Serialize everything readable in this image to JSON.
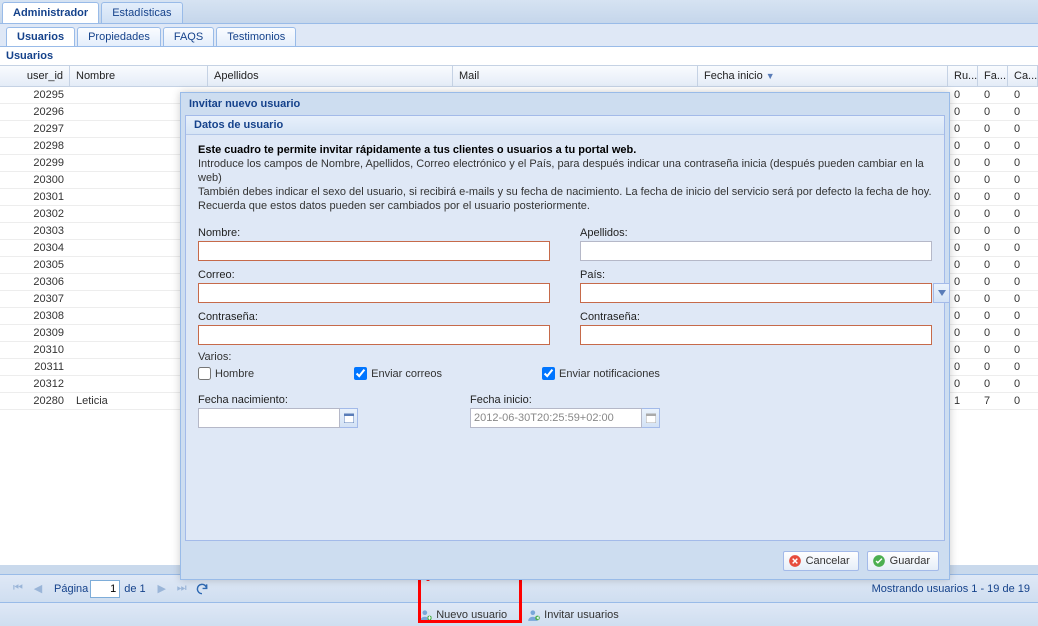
{
  "topTabs": {
    "admin": "Administrador",
    "stats": "Estadísticas"
  },
  "subTabs": {
    "users": "Usuarios",
    "props": "Propiedades",
    "faqs": "FAQS",
    "testi": "Testimonios"
  },
  "panelTitle": "Usuarios",
  "columns": {
    "user_id": "user_id",
    "nombre": "Nombre",
    "apellidos": "Apellidos",
    "mail": "Mail",
    "fecha": "Fecha inicio",
    "ru": "Ru...",
    "fa": "Fa...",
    "ca": "Ca..."
  },
  "rows": [
    {
      "id": "20295",
      "nom": "",
      "r": "0",
      "f": "0",
      "c": "0"
    },
    {
      "id": "20296",
      "nom": "",
      "r": "0",
      "f": "0",
      "c": "0"
    },
    {
      "id": "20297",
      "nom": "",
      "r": "0",
      "f": "0",
      "c": "0"
    },
    {
      "id": "20298",
      "nom": "",
      "r": "0",
      "f": "0",
      "c": "0"
    },
    {
      "id": "20299",
      "nom": "",
      "r": "0",
      "f": "0",
      "c": "0"
    },
    {
      "id": "20300",
      "nom": "",
      "r": "0",
      "f": "0",
      "c": "0"
    },
    {
      "id": "20301",
      "nom": "",
      "r": "0",
      "f": "0",
      "c": "0"
    },
    {
      "id": "20302",
      "nom": "",
      "r": "0",
      "f": "0",
      "c": "0"
    },
    {
      "id": "20303",
      "nom": "",
      "r": "0",
      "f": "0",
      "c": "0"
    },
    {
      "id": "20304",
      "nom": "",
      "r": "0",
      "f": "0",
      "c": "0"
    },
    {
      "id": "20305",
      "nom": "",
      "r": "0",
      "f": "0",
      "c": "0"
    },
    {
      "id": "20306",
      "nom": "",
      "r": "0",
      "f": "0",
      "c": "0"
    },
    {
      "id": "20307",
      "nom": "",
      "r": "0",
      "f": "0",
      "c": "0"
    },
    {
      "id": "20308",
      "nom": "",
      "r": "0",
      "f": "0",
      "c": "0"
    },
    {
      "id": "20309",
      "nom": "",
      "r": "0",
      "f": "0",
      "c": "0"
    },
    {
      "id": "20310",
      "nom": "",
      "r": "0",
      "f": "0",
      "c": "0"
    },
    {
      "id": "20311",
      "nom": "",
      "r": "0",
      "f": "0",
      "c": "0"
    },
    {
      "id": "20312",
      "nom": "",
      "r": "0",
      "f": "0",
      "c": "0"
    },
    {
      "id": "20280",
      "nom": "Leticia",
      "r": "1",
      "f": "7",
      "c": "0"
    }
  ],
  "paging": {
    "label": "Página",
    "value": "1",
    "of": "de 1",
    "status": "Mostrando usuarios 1 - 19 de 19"
  },
  "toolbar": {
    "newUser": "Nuevo usuario",
    "inviteUsers": "Invitar usuarios"
  },
  "dialog": {
    "title": "Invitar nuevo usuario",
    "fsTitle": "Datos de usuario",
    "introBold": "Este cuadro te permite invitar rápidamente a tus clientes o usuarios a tu portal web.",
    "intro1": "Introduce los campos de Nombre, Apellidos, Correo electrónico y el País, para después indicar una contraseña inicia (después pueden cambiar en la web)",
    "intro2": "También debes indicar el sexo del usuario, si recibirá e-mails y su fecha de nacimiento. La fecha de inicio del servicio será por defecto la fecha de hoy.",
    "intro3": "Recuerda que estos datos pueden ser cambiados por el usuario posteriormente.",
    "labels": {
      "nombre": "Nombre:",
      "apellidos": "Apellidos:",
      "correo": "Correo:",
      "pais": "País:",
      "pass1": "Contraseña:",
      "pass2": "Contraseña:",
      "varios": "Varios:",
      "hombre": "Hombre",
      "enviarCorreos": "Enviar correos",
      "enviarNotif": "Enviar notificaciones",
      "fechaNac": "Fecha nacimiento:",
      "fechaIni": "Fecha inicio:"
    },
    "fechaIniValue": "2012-06-30T20:25:59+02:00",
    "cancel": "Cancelar",
    "save": "Guardar"
  }
}
